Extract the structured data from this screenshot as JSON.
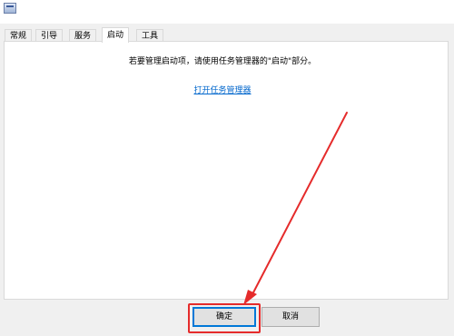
{
  "tabs": [
    {
      "label": "常规"
    },
    {
      "label": "引导"
    },
    {
      "label": "服务"
    },
    {
      "label": "启动"
    },
    {
      "label": "工具"
    }
  ],
  "active_tab": "启动",
  "panel": {
    "info_text": "若要管理启动项，请使用任务管理器的\"启动\"部分。",
    "link_text": "打开任务管理器"
  },
  "buttons": {
    "ok_label": "确定",
    "cancel_label": "取消"
  },
  "annotation": {
    "color": "#e52b2b"
  }
}
